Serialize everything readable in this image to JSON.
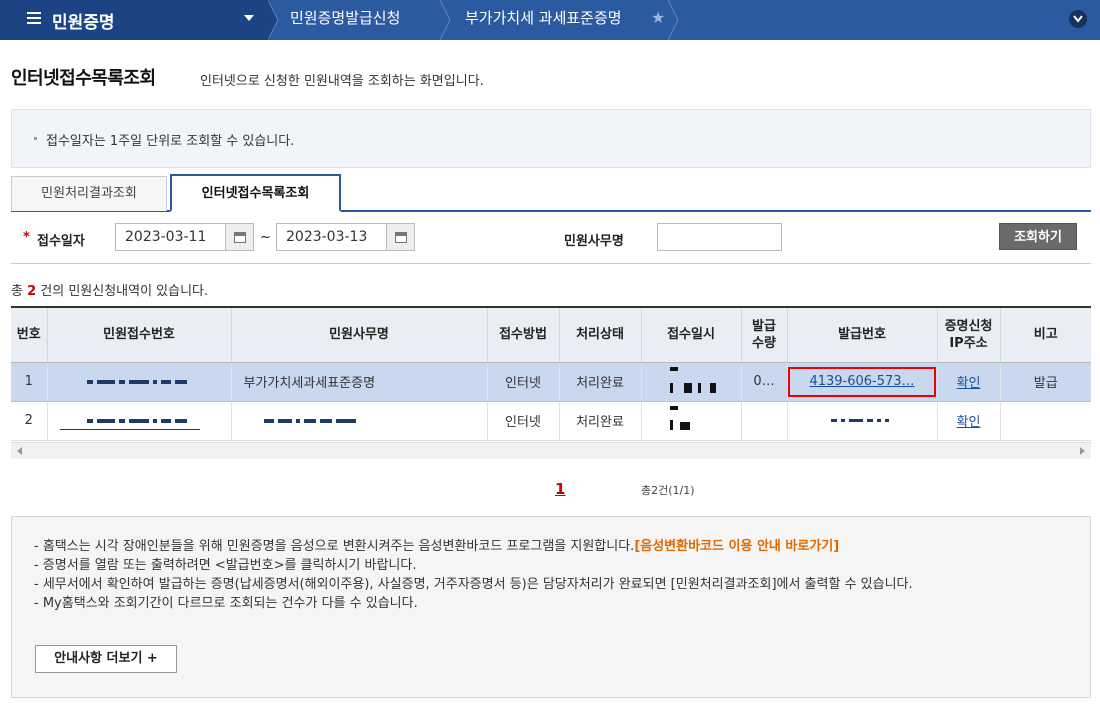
{
  "nav": {
    "menu_title": "민원증명",
    "crumb1": "민원증명발급신청",
    "crumb2": "부가가치세 과세표준증명"
  },
  "page": {
    "title": "인터넷접수목록조회",
    "desc": "인터넷으로 신청한 민원내역을 조회하는 화면입니다."
  },
  "notice": "접수일자는 1주일 단위로 조회할 수 있습니다.",
  "tabs": [
    "민원처리결과조회",
    "인터넷접수목록조회"
  ],
  "search": {
    "date_label": "접수일자",
    "date_from": "2023-03-11",
    "date_to": "2023-03-13",
    "tilde": "~",
    "office_label": "민원사무명",
    "office_value": "",
    "button": "조회하기"
  },
  "count": {
    "prefix": "총 ",
    "num": "2",
    "suffix": " 건의 민원신청내역이 있습니다."
  },
  "table": {
    "headers": [
      "번호",
      "민원접수번호",
      "민원사무명",
      "접수방법",
      "처리상태",
      "접수일시",
      "발급\n수량",
      "발급번호",
      "증명신청\nIP주소",
      "비고"
    ],
    "rows": [
      {
        "no": "1",
        "office": "부가가치세과세표준증명",
        "method": "인터넷",
        "status": "처리완료",
        "qty": "0…",
        "issue_no": "4139-606-573…",
        "ip": "확인",
        "note": "발급"
      },
      {
        "no": "2",
        "office": "",
        "method": "인터넷",
        "status": "처리완료",
        "qty": "",
        "issue_no": "",
        "ip": "확인",
        "note": ""
      }
    ]
  },
  "pager": {
    "page": "1",
    "total": "총2건(1/1)"
  },
  "info": {
    "line1": "- 홈택스는 시각 장애인분들을 위해 민원증명을 음성으로 변환시켜주는 음성변환바코드 프로그램을 지원합니다.",
    "line1_link": "[음성변환바코드 이용 안내 바로가기]",
    "line2": "- 증명서를 열람 또는 출력하려면 <발급번호>를 클릭하시기 바랍니다.",
    "line3": "- 세무서에서 확인하여 발급하는 증명(납세증명서(해외이주용), 사실증명, 거주자증명서 등)은 담당자처리가 완료되면 [민원처리결과조회]에서 출력할 수 있습니다.",
    "line4": "- My홈택스와 조회기간이 다르므로 조회되는 건수가 다를 수 있습니다.",
    "more_button": "안내사항 더보기 +"
  }
}
